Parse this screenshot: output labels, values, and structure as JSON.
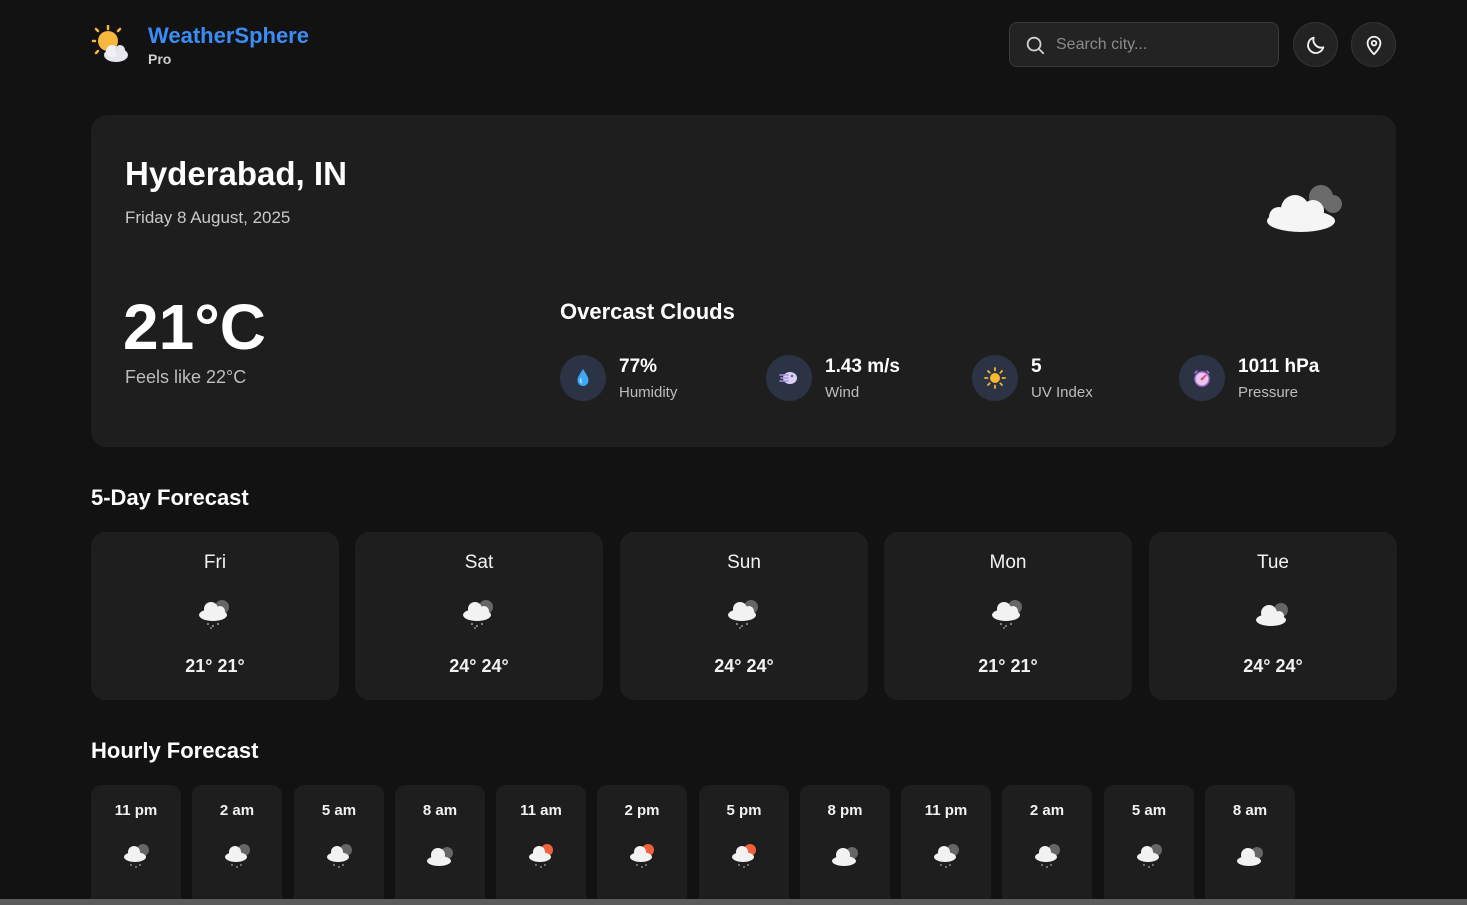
{
  "app": {
    "name": "WeatherSphere",
    "tier": "Pro"
  },
  "header": {
    "search_placeholder": "Search city...",
    "theme_toggle": "moon-icon",
    "location_button": "location-pin-icon"
  },
  "current": {
    "city": "Hyderabad, IN",
    "date": "Friday 8 August, 2025",
    "temperature": "21°C",
    "feels_like": "Feels like 22°C",
    "condition": "Overcast Clouds",
    "icon": "overcast-cloud-icon",
    "stats": [
      {
        "value": "77%",
        "label": "Humidity",
        "icon": "water-drop-icon"
      },
      {
        "value": "1.43 m/s",
        "label": "Wind",
        "icon": "wind-icon"
      },
      {
        "value": "5",
        "label": "UV Index",
        "icon": "sun-icon"
      },
      {
        "value": "1011 hPa",
        "label": "Pressure",
        "icon": "gauge-icon"
      }
    ]
  },
  "daily": {
    "title": "5-Day Forecast",
    "days": [
      {
        "name": "Fri",
        "temps": "21° 21°",
        "icon": "rain-cloud-icon"
      },
      {
        "name": "Sat",
        "temps": "24° 24°",
        "icon": "rain-cloud-icon"
      },
      {
        "name": "Sun",
        "temps": "24° 24°",
        "icon": "rain-cloud-icon"
      },
      {
        "name": "Mon",
        "temps": "21° 21°",
        "icon": "rain-cloud-icon"
      },
      {
        "name": "Tue",
        "temps": "24° 24°",
        "icon": "cloud-icon"
      }
    ]
  },
  "hourly": {
    "title": "Hourly Forecast",
    "hours": [
      {
        "time": "11 pm",
        "icon": "rain-cloud-icon"
      },
      {
        "time": "2 am",
        "icon": "rain-cloud-icon"
      },
      {
        "time": "5 am",
        "icon": "rain-cloud-icon"
      },
      {
        "time": "8 am",
        "icon": "cloud-icon"
      },
      {
        "time": "11 am",
        "icon": "sun-rain-cloud-icon"
      },
      {
        "time": "2 pm",
        "icon": "sun-rain-cloud-icon"
      },
      {
        "time": "5 pm",
        "icon": "sun-rain-cloud-icon"
      },
      {
        "time": "8 pm",
        "icon": "cloud-icon"
      },
      {
        "time": "11 pm",
        "icon": "rain-cloud-icon"
      },
      {
        "time": "2 am",
        "icon": "rain-cloud-icon"
      },
      {
        "time": "5 am",
        "icon": "rain-cloud-icon"
      },
      {
        "time": "8 am",
        "icon": "cloud-icon"
      }
    ]
  },
  "colors": {
    "accent": "#3b8df5",
    "background": "#121212",
    "card": "#1e1e1e"
  }
}
